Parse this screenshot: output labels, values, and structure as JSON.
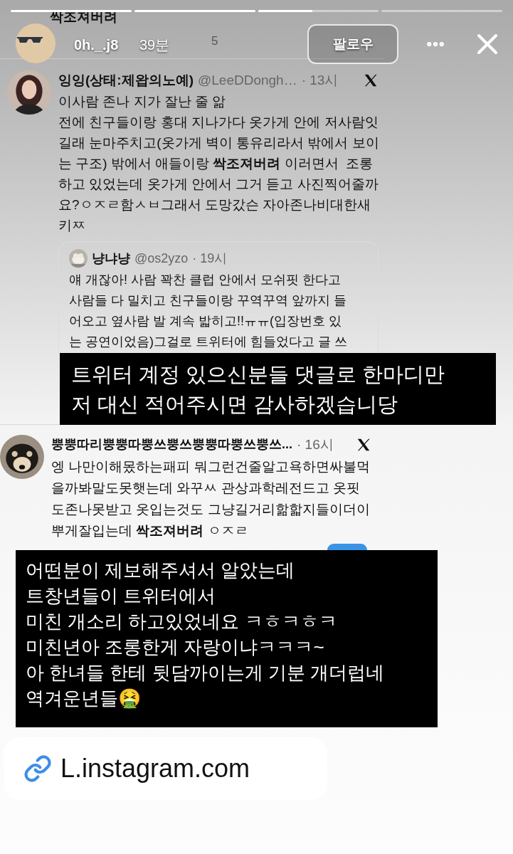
{
  "background_post": {
    "cut_text": "싹조져버려",
    "views": "5"
  },
  "story_header": {
    "progress": [
      {
        "level": 1
      },
      {
        "level": 1
      },
      {
        "level": 0.45
      },
      {
        "level": 0
      }
    ],
    "username": "0h._.j8",
    "time": "39분",
    "follow_label": "팔로우"
  },
  "tweets": [
    {
      "name": "잉잉(상태:제왑의노예)",
      "handle": "@LeeDDongh…",
      "time": "· 13시",
      "lines": [
        "이사람 존나 지가 잘난 줄 앎",
        "전에 친구들이랑 홍대 지나가다 옷가게 안에 저사람잇",
        "길래 눈마주치고(옷가게 벽이 통유리라서 밖에서 보이",
        "는 구조) 밖에서 애들이랑 **싹조져버려** 이러면서  조롱",
        "하고 있었는데 옷가게 안에서 그거 듣고 사진찍어줄까",
        "요?ㅇㅈㄹ함ㅅㅂ그래서 도망갔슨 자아존나비대한새",
        "키ㅉ"
      ],
      "quote": {
        "name": "냥냐냥",
        "handle": "@os2yzo",
        "time": "· 19시",
        "lines": [
          "얘 개잖아! 사람 꽉찬 클럽 안에서 모쉬핏 한다고",
          "사람들 다 밀치고 친구들이랑 꾸역꾸역 앞까지 들",
          "어오고 옆사람 발 계속 밟히고!!ㅠㅠ(입장번호 있",
          "는 공연이었음)그걸로 트위터에 힘들었다고 글 쓰"
        ]
      }
    },
    {
      "name": "뿡뿡따리뿡뿡따뿡쓰뿡쓰뿡뿡따뿡쓰뿡쓰...",
      "time": "· 16시",
      "lines": [
        "엥 나만이해몼하는패피 뭐그런건줄알고욕하면싸불먹",
        "을까봐말도못햇는데 와꾸ㅆ 관상과학레전드고 옷핏",
        "도존나못받고 옷입는것도 그냥길거리핢핣지들이더이",
        "뿌게잘입는데 **싹조져버려** ㅇㅈㄹ"
      ]
    }
  ],
  "captions": [
    {
      "lines": [
        "트위터 계정 있으신분들 댓글로 한마디만",
        "저 대신 적어주시면 감사하겠습니당"
      ]
    },
    {
      "lines": [
        "어떤분이 제보해주셔서 알았는데",
        "트창년들이 트위터에서",
        "미친 개소리 하고있었네요 ㅋㅎㅋㅎㅋ",
        "미친년아 조롱한게 자랑이냐ㅋㅋㅋ~",
        "아 한녀들 한테 뒷담까이는게 기분 개더럽네",
        "역겨운년들🤮"
      ]
    }
  ],
  "link_sticker": {
    "text": "L.instagram.com"
  }
}
